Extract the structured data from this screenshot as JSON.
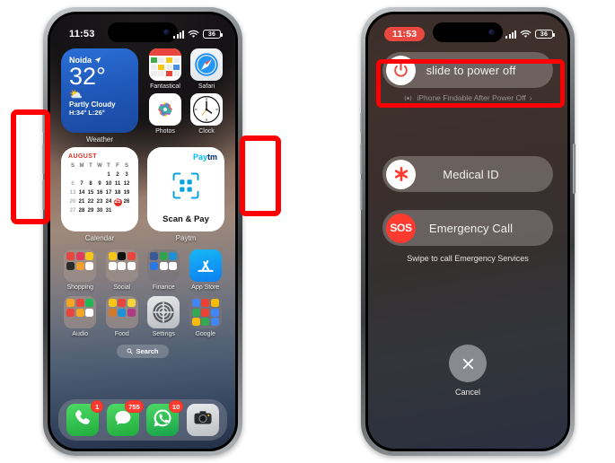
{
  "page": {
    "background": "#ffffff",
    "accent_red": "#ff0000"
  },
  "phone_left": {
    "name": "iPhone Home Screen",
    "status": {
      "time": "11:53",
      "battery": "36",
      "signal_icon": "signal-bars-icon",
      "wifi_icon": "wifi-icon",
      "battery_icon": "battery-icon"
    },
    "weather_widget": {
      "city": "Noida",
      "location_icon": "location-arrow-icon",
      "temperature": "32°",
      "condition_icon": "partly-cloudy-icon",
      "condition": "Partly Cloudy",
      "high_low": "H:34° L:26°",
      "label": "Weather"
    },
    "calendar_widget": {
      "month": "AUGUST",
      "weekday_headers": [
        "S",
        "M",
        "T",
        "W",
        "T",
        "F",
        "S"
      ],
      "weeks": [
        [
          "",
          "",
          "",
          "",
          "1",
          "2",
          "3"
        ],
        [
          "6",
          "7",
          "8",
          "9",
          "10",
          "11",
          "12"
        ],
        [
          "13",
          "14",
          "15",
          "16",
          "17",
          "18",
          "19"
        ],
        [
          "20",
          "21",
          "22",
          "23",
          "24",
          "25",
          "26"
        ],
        [
          "27",
          "28",
          "29",
          "30",
          "31",
          "",
          ""
        ]
      ],
      "today": "25",
      "dim_days": [
        "6",
        "13",
        "20",
        "27"
      ],
      "label": "Calendar"
    },
    "paytm_widget": {
      "brand_part1": "Pay",
      "brand_part2": "tm",
      "qr_icon": "qr-code-icon",
      "title": "Scan & Pay",
      "label": "Paytm"
    },
    "apps_row1": [
      {
        "name": "Fantastical",
        "icon": "fantastical-icon"
      },
      {
        "name": "Safari",
        "icon": "safari-compass-icon"
      }
    ],
    "apps_row2": [
      {
        "name": "Photos",
        "icon": "photos-pinwheel-icon"
      },
      {
        "name": "Clock",
        "icon": "clock-face-icon"
      }
    ],
    "app_grid": [
      {
        "name": "Shopping",
        "icon": "folder-icon",
        "type": "folder"
      },
      {
        "name": "Social",
        "icon": "folder-icon",
        "type": "folder"
      },
      {
        "name": "Finance",
        "icon": "folder-icon",
        "type": "folder"
      },
      {
        "name": "App Store",
        "icon": "app-store-icon",
        "type": "app"
      },
      {
        "name": "Audio",
        "icon": "folder-icon",
        "type": "folder"
      },
      {
        "name": "Food",
        "icon": "folder-icon",
        "type": "folder"
      },
      {
        "name": "Settings",
        "icon": "settings-gear-icon",
        "type": "app"
      },
      {
        "name": "Google",
        "icon": "folder-icon",
        "type": "folder"
      }
    ],
    "search": {
      "label": "Search",
      "icon": "search-icon"
    },
    "dock": [
      {
        "name": "Phone",
        "icon": "phone-handset-icon",
        "badge": "1"
      },
      {
        "name": "Messages",
        "icon": "messages-bubble-icon",
        "badge": "755"
      },
      {
        "name": "WhatsApp",
        "icon": "whatsapp-icon",
        "badge": "10"
      },
      {
        "name": "Camera",
        "icon": "camera-icon",
        "badge": ""
      }
    ],
    "annotations": [
      {
        "name": "volume-buttons-highlight",
        "color": "#ff0000"
      },
      {
        "name": "side-button-highlight",
        "color": "#ff0000"
      }
    ]
  },
  "phone_right": {
    "name": "Power Off Screen",
    "status": {
      "time": "11:53",
      "time_recording": true,
      "battery": "36",
      "signal_icon": "signal-bars-icon",
      "wifi_icon": "wifi-icon",
      "battery_icon": "battery-icon"
    },
    "power_slider": {
      "label": "slide to power off",
      "icon": "power-icon"
    },
    "findable_note": {
      "text": "iPhone Findable After Power Off",
      "icon": "findmy-waves-icon",
      "chevron": "›"
    },
    "medical_slider": {
      "label": "Medical ID",
      "icon": "medical-asterisk-icon"
    },
    "sos_slider": {
      "label": "Emergency Call",
      "icon": "sos-icon",
      "icon_text": "SOS"
    },
    "swipe_hint": "Swipe to call Emergency Services",
    "cancel": {
      "label": "Cancel",
      "icon": "close-x-icon"
    },
    "annotations": [
      {
        "name": "slide-to-power-off-highlight",
        "color": "#ff0000"
      }
    ]
  }
}
